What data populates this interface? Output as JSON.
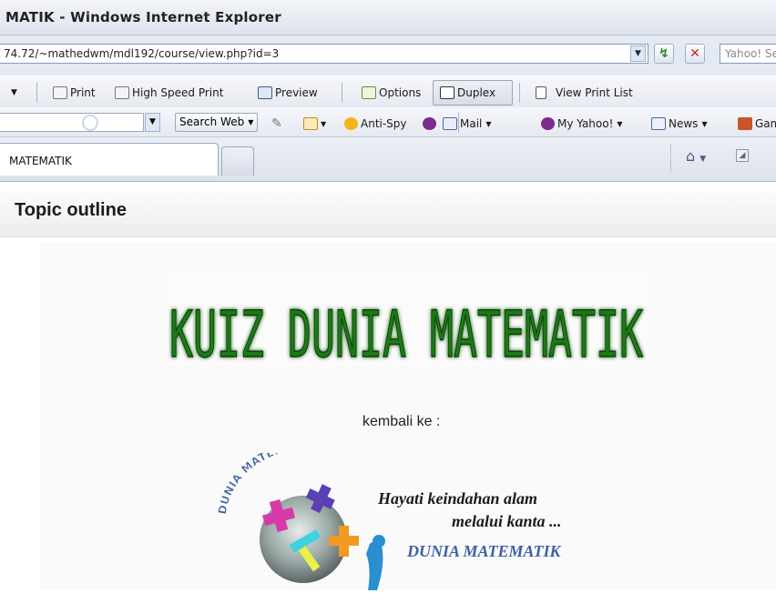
{
  "window": {
    "title": "MATIK - Windows Internet Explorer"
  },
  "address_bar": {
    "url": "74.72/~mathedwm/mdl192/course/view.php?id=3",
    "search_placeholder": "Yahoo! Se"
  },
  "print_toolbar": {
    "items": [
      "Print",
      "High Speed Print",
      "Preview",
      "Options",
      "Duplex",
      "View Print List"
    ]
  },
  "yahoo_toolbar": {
    "search_label": "Search Web",
    "items": [
      "Anti-Spy",
      "Mail",
      "My Yahoo!",
      "News",
      "Gam"
    ]
  },
  "tabs": {
    "active_label": "MATEMATIK"
  },
  "page": {
    "heading": "Topic outline",
    "banner_text": "KUIZ DUNIA MATEMATIK",
    "back_label": "kembali ke :",
    "logo_arc_text": "DUNIA MATEMATIK",
    "slogan_line1": "Hayati keindahan alam",
    "slogan_line2": "melalui kanta ...",
    "slogan_brand": "DUNIA MATEMATIK"
  },
  "colors": {
    "banner_green": "#1f7a14",
    "brand_blue": "#3f5fa6",
    "ie_chrome": "#e5e9f2"
  },
  "icons": [
    "print-icon",
    "preview-icon",
    "options-icon",
    "duplex-icon",
    "print-list-icon",
    "magnifier-icon",
    "pen-icon",
    "antispy-icon",
    "mail-icon",
    "my-yahoo-icon",
    "news-icon",
    "games-icon",
    "home-icon",
    "rss-icon",
    "refresh-icon",
    "stop-icon"
  ]
}
